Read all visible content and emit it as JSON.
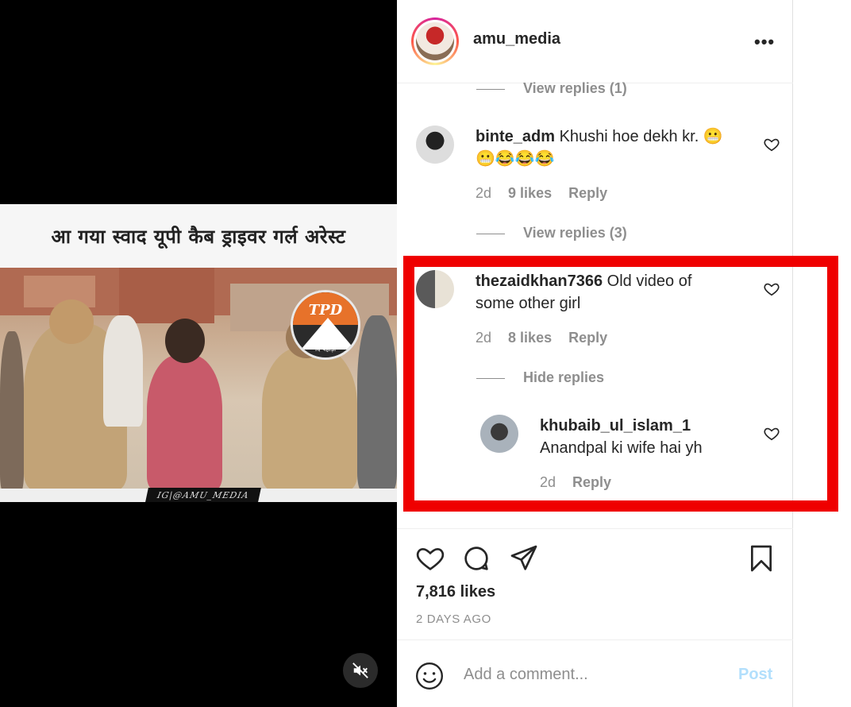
{
  "video": {
    "caption": "आ गया स्वाद यूपी कैब ड्राइवर गर्ल  अरेस्ट",
    "logo_text": "TPD",
    "logo_subtext": "दि पहाड़ी",
    "watermark": "IG|@AMU_MEDIA",
    "mute_icon": "speaker-muted-icon"
  },
  "post": {
    "username": "amu_media",
    "more_icon": "•••"
  },
  "comments": {
    "view_replies_prev": "View replies (1)",
    "c1": {
      "user": "binte_adm",
      "text": "Khushi hoe dekh kr. 😬",
      "text2": "😬😂😂😂",
      "age": "2d",
      "likes": "9 likes",
      "reply": "Reply",
      "view_replies": "View replies (3)"
    },
    "c2": {
      "user": "thezaidkhan7366",
      "text": "Old video of",
      "text2": "some other girl",
      "age": "2d",
      "likes": "8 likes",
      "reply": "Reply",
      "hide_replies": "Hide replies"
    },
    "r1": {
      "user": "khubaib_ul_islam_1",
      "text": "Anandpal ki wife hai yh",
      "age": "2d",
      "reply": "Reply"
    }
  },
  "footer": {
    "likes": "7,816 likes",
    "time_ago": "2 DAYS AGO",
    "comment_placeholder": "Add a comment...",
    "post_label": "Post"
  },
  "colors": {
    "highlight": "#ef0000",
    "muted": "#8e8e8e",
    "post_disabled": "#b2dffc"
  }
}
